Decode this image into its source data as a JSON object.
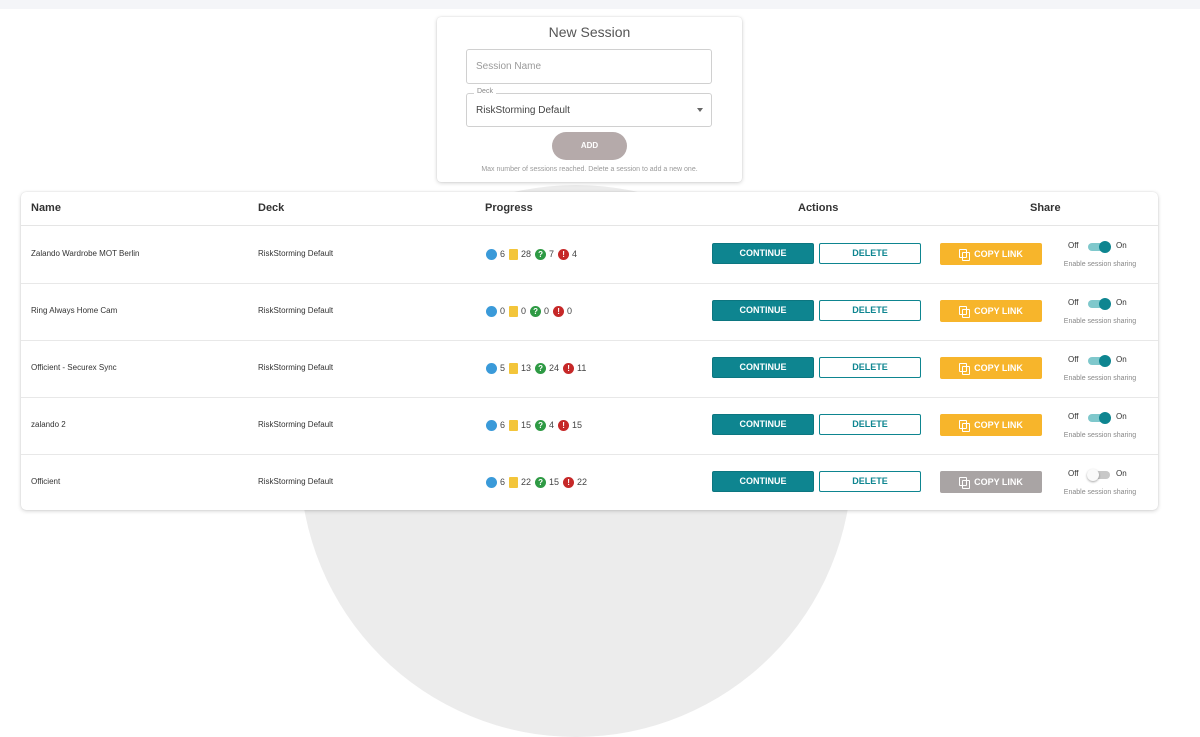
{
  "new_session": {
    "title": "New Session",
    "name_placeholder": "Session Name",
    "deck_label": "Deck",
    "deck_value": "RiskStorming Default",
    "add_label": "ADD",
    "hint": "Max number of sessions reached. Delete a session to add a new one."
  },
  "table": {
    "headers": {
      "name": "Name",
      "deck": "Deck",
      "progress": "Progress",
      "actions": "Actions",
      "share": "Share"
    },
    "continue_label": "CONTINUE",
    "delete_label": "DELETE",
    "copy_label": "COPY LINK",
    "off_label": "Off",
    "on_label": "On",
    "share_caption": "Enable session sharing",
    "rows": [
      {
        "name": "Zalando Wardrobe MOT Berlin",
        "deck": "RiskStorming Default",
        "progress": {
          "blue": "6",
          "yellow": "28",
          "green": "7",
          "red": "4"
        },
        "sharing": true
      },
      {
        "name": "Ring Always Home Cam",
        "deck": "RiskStorming Default",
        "progress": {
          "blue": "0",
          "yellow": "0",
          "green": "0",
          "red": "0"
        },
        "sharing": true
      },
      {
        "name": "Officient - Securex Sync",
        "deck": "RiskStorming Default",
        "progress": {
          "blue": "5",
          "yellow": "13",
          "green": "24",
          "red": "11"
        },
        "sharing": true
      },
      {
        "name": "zalando 2",
        "deck": "RiskStorming Default",
        "progress": {
          "blue": "6",
          "yellow": "15",
          "green": "4",
          "red": "15"
        },
        "sharing": true
      },
      {
        "name": "Officient",
        "deck": "RiskStorming Default",
        "progress": {
          "blue": "6",
          "yellow": "22",
          "green": "15",
          "red": "22"
        },
        "sharing": false
      }
    ]
  },
  "colors": {
    "teal": "#0e8590",
    "copy_enabled": "#f7b52b",
    "copy_disabled": "#a9a4a4",
    "progress_blue": "#3a9ad9",
    "progress_yellow": "#f3c53a",
    "progress_green": "#2e9a44",
    "progress_red": "#c62828"
  },
  "icons": {
    "progress_blue": "circle-icon",
    "progress_yellow": "card-icon",
    "progress_green": "question-icon",
    "progress_red": "exclamation-icon",
    "copy": "copy-icon",
    "select": "caret-down-icon"
  }
}
